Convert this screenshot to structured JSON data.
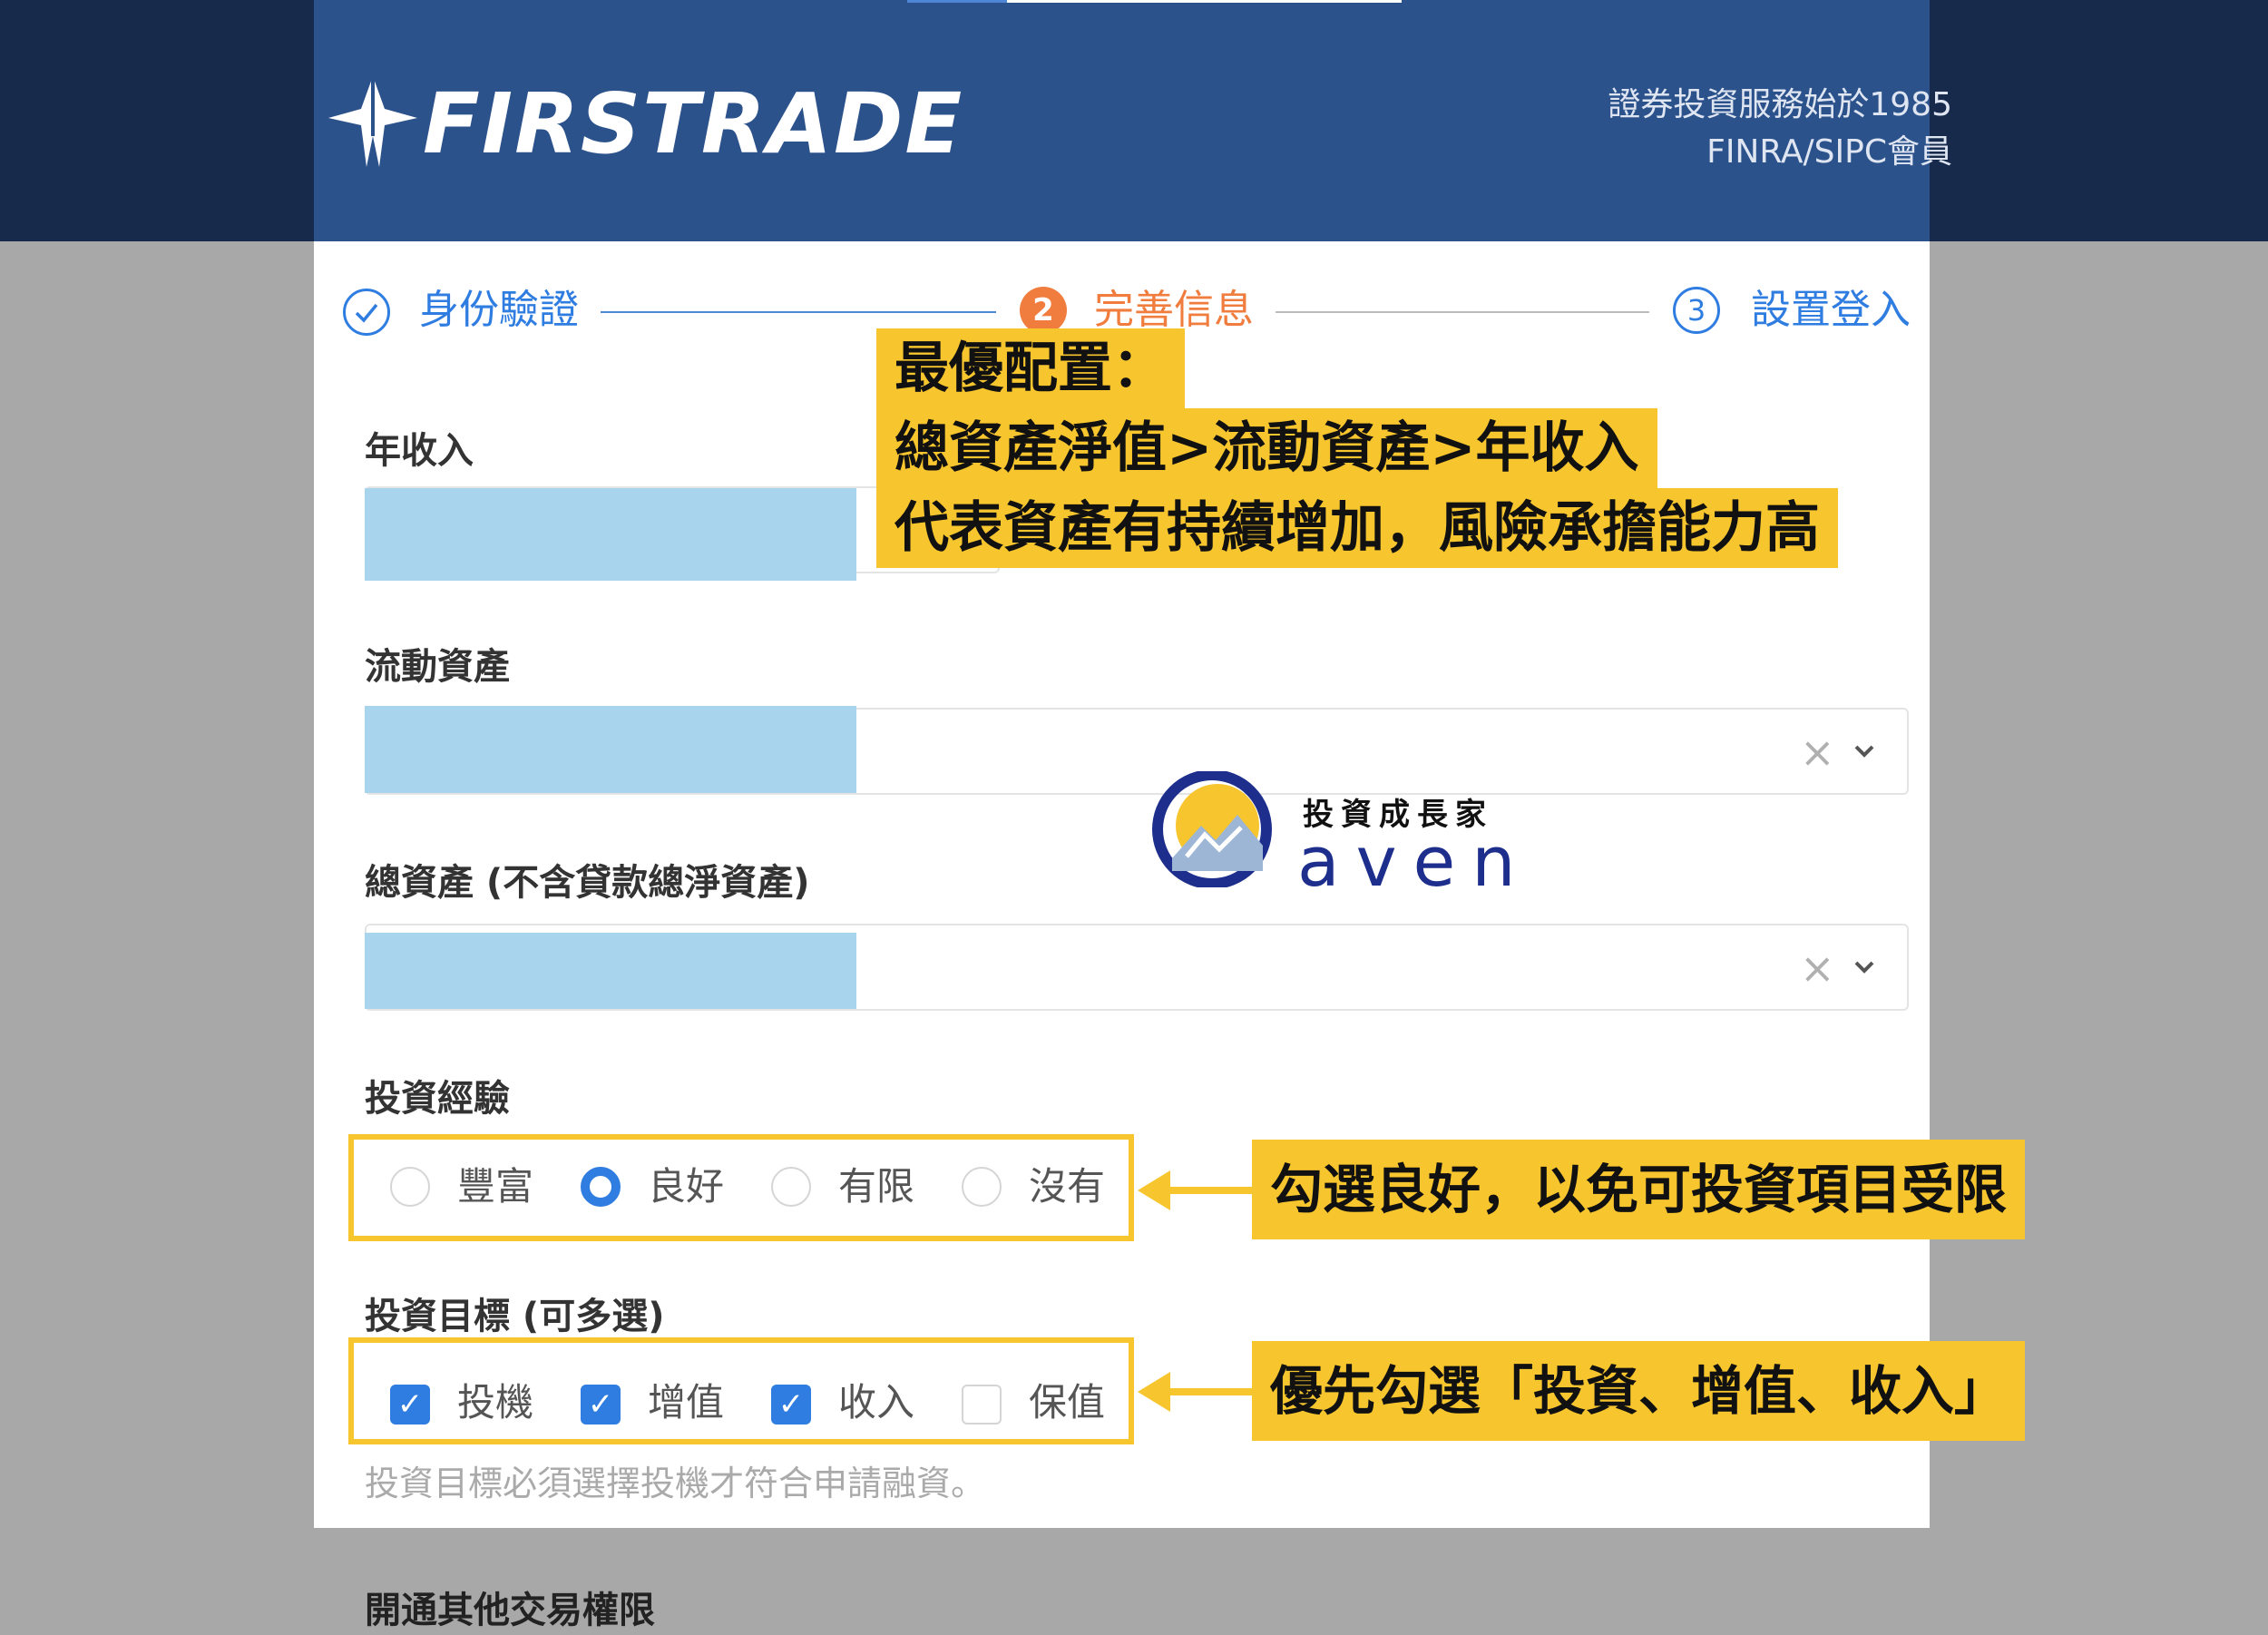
{
  "header": {
    "brand": "FIRSTRADE",
    "tagline_line1": "證券投資服務始於1985",
    "tagline_line2": "FINRA/SIPC會員"
  },
  "steps": [
    {
      "label": "身份驗證",
      "status": "done",
      "icon": "check-icon"
    },
    {
      "label": "完善信息",
      "number": "2",
      "status": "active"
    },
    {
      "label": "設置登入",
      "number": "3",
      "status": "pending"
    }
  ],
  "colors": {
    "header_blue": "#2c528c",
    "accent_blue": "#2f7de1",
    "active_orange": "#f07c3e",
    "highlight_yellow": "#f7c52e",
    "mask_blue": "#a9d4ee"
  },
  "fields": {
    "annual_income_label": "年收入",
    "liquid_assets_label": "流動資產",
    "total_assets_label": "總資產 (不含貸款總淨資產)",
    "clear_icon": "×",
    "chevron_icon": "⌄"
  },
  "experience": {
    "label": "投資經驗",
    "options": [
      {
        "label": "豐富",
        "selected": false
      },
      {
        "label": "良好",
        "selected": true
      },
      {
        "label": "有限",
        "selected": false
      },
      {
        "label": "沒有",
        "selected": false
      }
    ]
  },
  "goals": {
    "label": "投資目標 (可多選)",
    "options": [
      {
        "label": "投機",
        "checked": true
      },
      {
        "label": "增值",
        "checked": true
      },
      {
        "label": "收入",
        "checked": true
      },
      {
        "label": "保值",
        "checked": false
      }
    ],
    "check_glyph": "✓",
    "hint": "投資目標必須選擇投機才符合申請融資。"
  },
  "bottom_section_label": "開通其他交易權限",
  "annotations": {
    "top_line1": "最優配置：",
    "top_line2": "總資產淨值>流動資產>年收入",
    "top_line3": "代表資產有持續增加，風險承擔能力高",
    "experience_note": "勾選良好，以免可投資項目受限",
    "goals_note": "優先勾選「投資、增值、收入」"
  },
  "watermark": {
    "small": "投資成長家",
    "big": "aven"
  }
}
